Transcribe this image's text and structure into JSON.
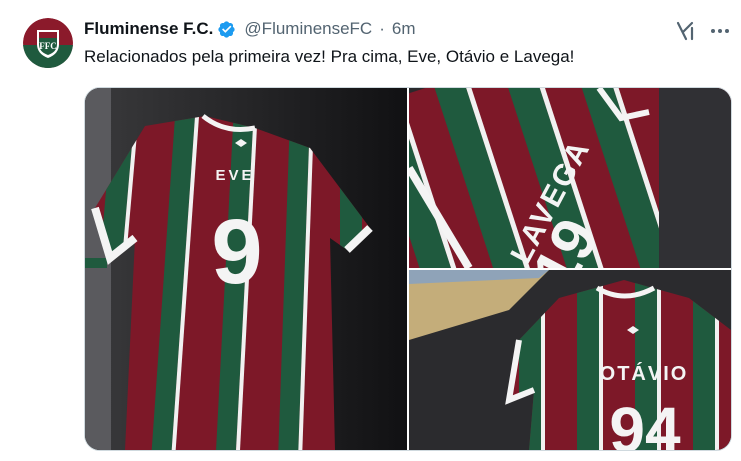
{
  "tweet": {
    "author_name": "Fluminense F.C.",
    "handle": "@FluminenseFC",
    "separator": "·",
    "time": "6m",
    "text": "Relacionados pela primeira vez! Pra cima, Eve, Otávio e Lavega!"
  },
  "icons": {
    "verified": "verified-badge-icon",
    "grok": "grok-icon",
    "more": "more-options-icon"
  },
  "media": {
    "photos": [
      {
        "shirt_name": "EVE",
        "shirt_number": "9"
      },
      {
        "shirt_name": "LAVEGA",
        "shirt_number": "19"
      },
      {
        "shirt_name": "OTÁVIO",
        "shirt_number": "94"
      }
    ]
  },
  "colors": {
    "verified": "#1d9bf0",
    "grena": "#8b1a2b",
    "verde": "#1f5a3e",
    "text_secondary": "#536471"
  }
}
